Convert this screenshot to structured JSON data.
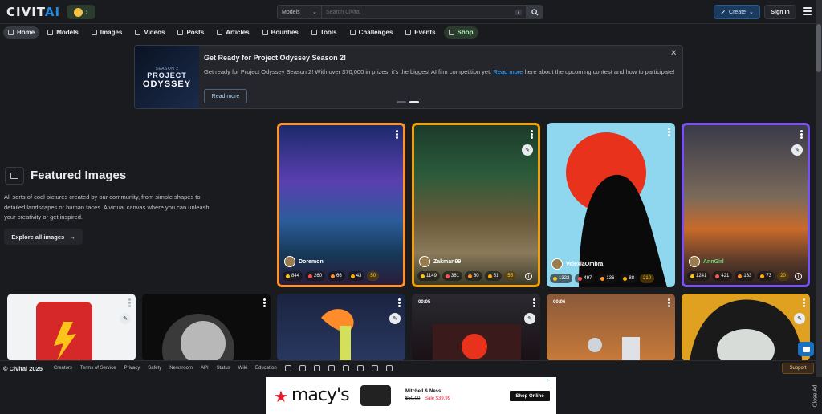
{
  "header": {
    "logo_main": "CIVIT",
    "logo_ai": "AI",
    "search_select": "Models",
    "search_placeholder": "Search Civitai",
    "search_shortcut": "/",
    "create_label": "Create",
    "signin_label": "Sign In"
  },
  "nav": {
    "items": [
      {
        "label": "Home",
        "icon": "home-icon"
      },
      {
        "label": "Models",
        "icon": "models-icon"
      },
      {
        "label": "Images",
        "icon": "images-icon"
      },
      {
        "label": "Videos",
        "icon": "videos-icon"
      },
      {
        "label": "Posts",
        "icon": "posts-icon"
      },
      {
        "label": "Articles",
        "icon": "articles-icon"
      },
      {
        "label": "Bounties",
        "icon": "bounties-icon"
      },
      {
        "label": "Tools",
        "icon": "tools-icon"
      },
      {
        "label": "Challenges",
        "icon": "challenges-icon"
      },
      {
        "label": "Events",
        "icon": "events-icon"
      },
      {
        "label": "Shop",
        "icon": "shop-icon"
      }
    ]
  },
  "banner": {
    "thumb_top": "SEASON 2",
    "thumb_project": "PROJECT",
    "thumb_odyssey": "ODYSSEY",
    "title": "Get Ready for Project Odyssey Season 2!",
    "desc_before": "Get ready for Project Odyssey Season 2! With over $70,000 in prizes, it's the biggest AI film competition yet. ",
    "desc_link": "Read more",
    "desc_after": " here about the upcoming contest and how to participate!",
    "read_more": "Read more"
  },
  "featured": {
    "title": "Featured Images",
    "description": "All sorts of cool pictures created by our community, from simple shapes to detailed landscapes or human faces. A virtual canvas where you can unleash your creativity or get inspired.",
    "explore_label": "Explore all images",
    "explore_arrow": "→"
  },
  "cards_top": [
    {
      "user": "Doremon",
      "likes": "844",
      "hearts": "260",
      "laughs": "66",
      "cries": "43",
      "buzz": "50"
    },
    {
      "user": "Zakman99",
      "likes": "1149",
      "hearts": "361",
      "laughs": "80",
      "cries": "51",
      "buzz": "55"
    },
    {
      "user": "VelexiaOmbra",
      "likes": "1322",
      "hearts": "497",
      "laughs": "136",
      "cries": "88",
      "buzz": "210"
    },
    {
      "user": "AnnGirl",
      "likes": "1241",
      "hearts": "421",
      "laughs": "133",
      "cries": "73",
      "buzz": "20"
    }
  ],
  "cards_bottom": [
    {
      "duration": ""
    },
    {
      "duration": ""
    },
    {
      "duration": ""
    },
    {
      "duration": "00:05"
    },
    {
      "duration": "00:06"
    },
    {
      "duration": ""
    }
  ],
  "footer": {
    "copyright": "© Civitai 2025",
    "links": [
      "Creators",
      "Terms of Service",
      "Privacy",
      "Safety",
      "Newsroom",
      "API",
      "Status",
      "Wiki",
      "Education"
    ],
    "support": "Support"
  },
  "ad": {
    "brand": "macy's",
    "product_name": "Mitchell & Ness",
    "old_price": "$50.00",
    "sale_price": "Sale $39.99",
    "cta": "Shop Online",
    "close": "Close Ad"
  },
  "colors": {
    "accent": "#228be6",
    "background": "#1a1b1e",
    "surface": "#25262b"
  }
}
